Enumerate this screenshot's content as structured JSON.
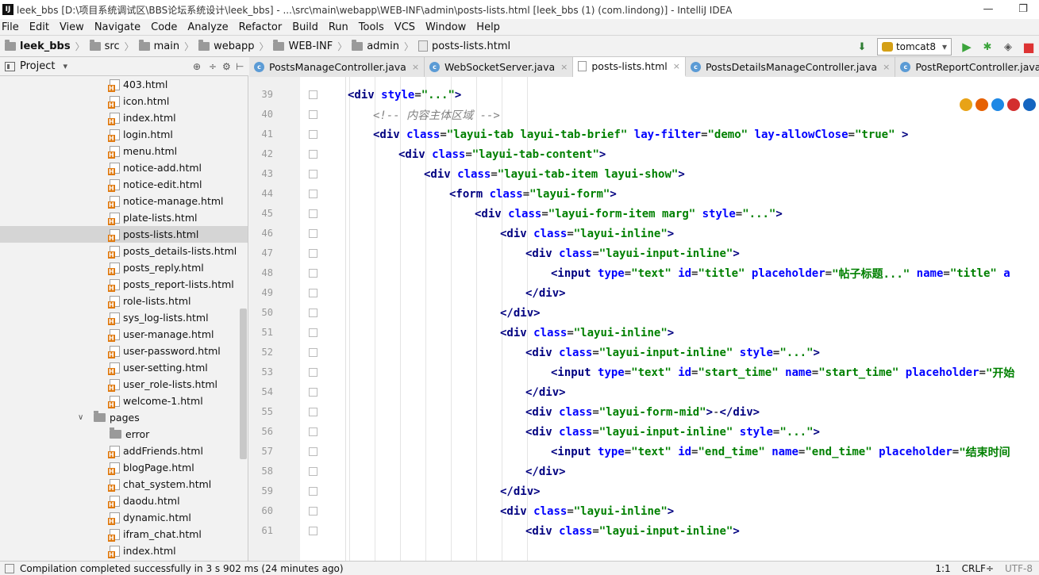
{
  "window": {
    "app_logo": "IJ",
    "title": "leek_bbs [D:\\项目系统调试区\\BBS论坛系统设计\\leek_bbs] - ...\\src\\main\\webapp\\WEB-INF\\admin\\posts-lists.html [leek_bbs (1) (com.lindong)] - IntelliJ IDEA",
    "minimize": "—",
    "maximize": "❐"
  },
  "menu": [
    "File",
    "Edit",
    "View",
    "Navigate",
    "Code",
    "Analyze",
    "Refactor",
    "Build",
    "Run",
    "Tools",
    "VCS",
    "Window",
    "Help"
  ],
  "breadcrumb": [
    "leek_bbs",
    "src",
    "main",
    "webapp",
    "WEB-INF",
    "admin",
    "posts-lists.html"
  ],
  "run_config": {
    "name": "tomcat8",
    "arrow": "▾"
  },
  "toolbar_icons": {
    "run": "▶",
    "debug": "✱",
    "coverage": "◈",
    "stop": "■",
    "build": "⬇"
  },
  "project_panel": {
    "title": "Project",
    "arrow": "▾",
    "icons": [
      "⊕",
      "÷",
      "⚙",
      "⊢"
    ]
  },
  "tree": [
    {
      "label": "403.html",
      "type": "file"
    },
    {
      "label": "icon.html",
      "type": "file"
    },
    {
      "label": "index.html",
      "type": "file"
    },
    {
      "label": "login.html",
      "type": "file"
    },
    {
      "label": "menu.html",
      "type": "file"
    },
    {
      "label": "notice-add.html",
      "type": "file"
    },
    {
      "label": "notice-edit.html",
      "type": "file"
    },
    {
      "label": "notice-manage.html",
      "type": "file"
    },
    {
      "label": "plate-lists.html",
      "type": "file"
    },
    {
      "label": "posts-lists.html",
      "type": "file",
      "selected": true
    },
    {
      "label": "posts_details-lists.html",
      "type": "file"
    },
    {
      "label": "posts_reply.html",
      "type": "file"
    },
    {
      "label": "posts_report-lists.html",
      "type": "file"
    },
    {
      "label": "role-lists.html",
      "type": "file"
    },
    {
      "label": "sys_log-lists.html",
      "type": "file"
    },
    {
      "label": "user-manage.html",
      "type": "file"
    },
    {
      "label": "user-password.html",
      "type": "file"
    },
    {
      "label": "user-setting.html",
      "type": "file"
    },
    {
      "label": "user_role-lists.html",
      "type": "file"
    },
    {
      "label": "welcome-1.html",
      "type": "file"
    },
    {
      "label": "pages",
      "type": "folder",
      "expanded": true
    },
    {
      "label": "error",
      "type": "folder"
    },
    {
      "label": "addFriends.html",
      "type": "file"
    },
    {
      "label": "blogPage.html",
      "type": "file"
    },
    {
      "label": "chat_system.html",
      "type": "file"
    },
    {
      "label": "daodu.html",
      "type": "file"
    },
    {
      "label": "dynamic.html",
      "type": "file"
    },
    {
      "label": "ifram_chat.html",
      "type": "file"
    },
    {
      "label": "index.html",
      "type": "file"
    }
  ],
  "tabs": [
    {
      "label": "PostsManageController.java",
      "kind": "java"
    },
    {
      "label": "WebSocketServer.java",
      "kind": "java"
    },
    {
      "label": "posts-lists.html",
      "kind": "html",
      "active": true
    },
    {
      "label": "PostsDetailsManageController.java",
      "kind": "java"
    },
    {
      "label": "PostReportController.java",
      "kind": "java"
    }
  ],
  "code": [
    {
      "n": 39,
      "indent": 0,
      "parts": [
        [
          "tag",
          "<div "
        ],
        [
          "attr",
          "style"
        ],
        [
          "plain",
          "="
        ],
        [
          "val",
          "\"...\""
        ],
        [
          "tag",
          ">"
        ]
      ]
    },
    {
      "n": 40,
      "indent": 1,
      "parts": [
        [
          "cmt",
          "<!-- 内容主体区域 -->"
        ]
      ]
    },
    {
      "n": 41,
      "indent": 1,
      "parts": [
        [
          "tag",
          "<div "
        ],
        [
          "attr",
          "class"
        ],
        [
          "plain",
          "="
        ],
        [
          "val",
          "\"layui-tab layui-tab-brief\" "
        ],
        [
          "attr",
          "lay-filter"
        ],
        [
          "plain",
          "="
        ],
        [
          "val",
          "\"demo\" "
        ],
        [
          "attr",
          "lay-allowClose"
        ],
        [
          "plain",
          "="
        ],
        [
          "val",
          "\"true\" "
        ],
        [
          "tag",
          ">"
        ]
      ]
    },
    {
      "n": 42,
      "indent": 2,
      "parts": [
        [
          "tag",
          "<div "
        ],
        [
          "attr",
          "class"
        ],
        [
          "plain",
          "="
        ],
        [
          "val",
          "\"layui-tab-content\""
        ],
        [
          "tag",
          ">"
        ]
      ]
    },
    {
      "n": 43,
      "indent": 3,
      "parts": [
        [
          "tag",
          "<div "
        ],
        [
          "attr",
          "class"
        ],
        [
          "plain",
          "="
        ],
        [
          "val",
          "\"layui-tab-item layui-show\""
        ],
        [
          "tag",
          ">"
        ]
      ]
    },
    {
      "n": 44,
      "indent": 4,
      "parts": [
        [
          "tag",
          "<form "
        ],
        [
          "attr",
          "class"
        ],
        [
          "plain",
          "="
        ],
        [
          "val",
          "\"layui-form\""
        ],
        [
          "tag",
          ">"
        ]
      ]
    },
    {
      "n": 45,
      "indent": 5,
      "parts": [
        [
          "tag",
          "<div "
        ],
        [
          "attr",
          "class"
        ],
        [
          "plain",
          "="
        ],
        [
          "val",
          "\"layui-form-item marg\" "
        ],
        [
          "attr",
          "style"
        ],
        [
          "plain",
          "="
        ],
        [
          "val",
          "\"...\""
        ],
        [
          "tag",
          ">"
        ]
      ]
    },
    {
      "n": 46,
      "indent": 6,
      "parts": [
        [
          "tag",
          "<div "
        ],
        [
          "attr",
          "class"
        ],
        [
          "plain",
          "="
        ],
        [
          "val",
          "\"layui-inline\""
        ],
        [
          "tag",
          ">"
        ]
      ]
    },
    {
      "n": 47,
      "indent": 7,
      "parts": [
        [
          "tag",
          "<div "
        ],
        [
          "attr",
          "class"
        ],
        [
          "plain",
          "="
        ],
        [
          "val",
          "\"layui-input-inline\""
        ],
        [
          "tag",
          ">"
        ]
      ]
    },
    {
      "n": 48,
      "indent": 8,
      "parts": [
        [
          "tag",
          "<input "
        ],
        [
          "attr",
          "type"
        ],
        [
          "plain",
          "="
        ],
        [
          "val",
          "\"text\" "
        ],
        [
          "attr",
          "id"
        ],
        [
          "plain",
          "="
        ],
        [
          "val",
          "\"title\" "
        ],
        [
          "attr",
          "placeholder"
        ],
        [
          "plain",
          "="
        ],
        [
          "val",
          "\"帖子标题...\" "
        ],
        [
          "attr",
          "name"
        ],
        [
          "plain",
          "="
        ],
        [
          "val",
          "\"title\" "
        ],
        [
          "attr",
          "a"
        ]
      ]
    },
    {
      "n": 49,
      "indent": 7,
      "parts": [
        [
          "tag",
          "</div>"
        ]
      ]
    },
    {
      "n": 50,
      "indent": 6,
      "parts": [
        [
          "tag",
          "</div>"
        ]
      ]
    },
    {
      "n": 51,
      "indent": 6,
      "parts": [
        [
          "tag",
          "<div "
        ],
        [
          "attr",
          "class"
        ],
        [
          "plain",
          "="
        ],
        [
          "val",
          "\"layui-inline\""
        ],
        [
          "tag",
          ">"
        ]
      ]
    },
    {
      "n": 52,
      "indent": 7,
      "parts": [
        [
          "tag",
          "<div "
        ],
        [
          "attr",
          "class"
        ],
        [
          "plain",
          "="
        ],
        [
          "val",
          "\"layui-input-inline\" "
        ],
        [
          "attr",
          "style"
        ],
        [
          "plain",
          "="
        ],
        [
          "val",
          "\"...\""
        ],
        [
          "tag",
          ">"
        ]
      ]
    },
    {
      "n": 53,
      "indent": 8,
      "parts": [
        [
          "tag",
          "<input "
        ],
        [
          "attr",
          "type"
        ],
        [
          "plain",
          "="
        ],
        [
          "val",
          "\"text\" "
        ],
        [
          "attr",
          "id"
        ],
        [
          "plain",
          "="
        ],
        [
          "val",
          "\"start_time\" "
        ],
        [
          "attr",
          "name"
        ],
        [
          "plain",
          "="
        ],
        [
          "val",
          "\"start_time\" "
        ],
        [
          "attr",
          "placeholder"
        ],
        [
          "plain",
          "="
        ],
        [
          "val",
          "\"开始"
        ]
      ]
    },
    {
      "n": 54,
      "indent": 7,
      "parts": [
        [
          "tag",
          "</div>"
        ]
      ]
    },
    {
      "n": 55,
      "indent": 7,
      "parts": [
        [
          "tag",
          "<div "
        ],
        [
          "attr",
          "class"
        ],
        [
          "plain",
          "="
        ],
        [
          "val",
          "\"layui-form-mid\""
        ],
        [
          "tag",
          ">"
        ],
        [
          "plain",
          "-"
        ],
        [
          "tag",
          "</div>"
        ]
      ]
    },
    {
      "n": 56,
      "indent": 7,
      "parts": [
        [
          "tag",
          "<div "
        ],
        [
          "attr",
          "class"
        ],
        [
          "plain",
          "="
        ],
        [
          "val",
          "\"layui-input-inline\" "
        ],
        [
          "attr",
          "style"
        ],
        [
          "plain",
          "="
        ],
        [
          "val",
          "\"...\""
        ],
        [
          "tag",
          ">"
        ]
      ]
    },
    {
      "n": 57,
      "indent": 8,
      "parts": [
        [
          "tag",
          "<input "
        ],
        [
          "attr",
          "type"
        ],
        [
          "plain",
          "="
        ],
        [
          "val",
          "\"text\" "
        ],
        [
          "attr",
          "id"
        ],
        [
          "plain",
          "="
        ],
        [
          "val",
          "\"end_time\" "
        ],
        [
          "attr",
          "name"
        ],
        [
          "plain",
          "="
        ],
        [
          "val",
          "\"end_time\" "
        ],
        [
          "attr",
          "placeholder"
        ],
        [
          "plain",
          "="
        ],
        [
          "val",
          "\"结束时间"
        ]
      ]
    },
    {
      "n": 58,
      "indent": 7,
      "parts": [
        [
          "tag",
          "</div>"
        ]
      ]
    },
    {
      "n": 59,
      "indent": 6,
      "parts": [
        [
          "tag",
          "</div>"
        ]
      ]
    },
    {
      "n": 60,
      "indent": 6,
      "parts": [
        [
          "tag",
          "<div "
        ],
        [
          "attr",
          "class"
        ],
        [
          "plain",
          "="
        ],
        [
          "val",
          "\"layui-inline\""
        ],
        [
          "tag",
          ">"
        ]
      ]
    },
    {
      "n": 61,
      "indent": 7,
      "parts": [
        [
          "tag",
          "<div "
        ],
        [
          "attr",
          "class"
        ],
        [
          "plain",
          "="
        ],
        [
          "val",
          "\"layui-input-inline\""
        ],
        [
          "tag",
          ">"
        ]
      ]
    }
  ],
  "browser_icons": [
    {
      "name": "chrome-icon",
      "color": "#e8a317"
    },
    {
      "name": "firefox-icon",
      "color": "#e66000"
    },
    {
      "name": "safari-icon",
      "color": "#1e88e5"
    },
    {
      "name": "opera-icon",
      "color": "#d32f2f"
    },
    {
      "name": "ie-icon",
      "color": "#1565c0"
    }
  ],
  "status": {
    "message": "Compilation completed successfully in 3 s 902 ms (24 minutes ago)",
    "position": "1:1",
    "line_sep": "CRLF÷",
    "encoding": "UTF-8"
  },
  "colors": {
    "tag": "#000080",
    "attr": "#0000ff",
    "value": "#008000",
    "comment": "#808080"
  }
}
